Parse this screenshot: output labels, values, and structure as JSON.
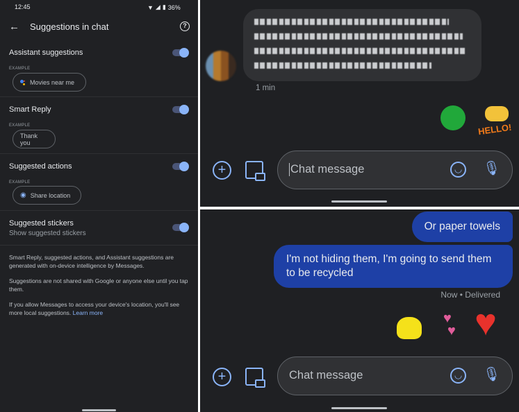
{
  "status_bar": {
    "time": "12:45",
    "battery": "36%"
  },
  "settings": {
    "title": "Suggestions in chat",
    "sections": [
      {
        "label": "Assistant suggestions",
        "example_label": "EXAMPLE",
        "chip": "Movies near me",
        "enabled": true
      },
      {
        "label": "Smart Reply",
        "example_label": "EXAMPLE",
        "chip": "Thank you",
        "enabled": true
      },
      {
        "label": "Suggested actions",
        "example_label": "EXAMPLE",
        "chip": "Share location",
        "enabled": true
      },
      {
        "label": "Suggested stickers",
        "subtitle": "Show suggested stickers",
        "enabled": true
      }
    ],
    "info": [
      "Smart Reply, suggested actions, and Assistant suggestions are generated with on-device intelligence by Messages.",
      "Suggestions are not shared with Google or anyone else until you tap them.",
      "If you allow Messages to access your device's location, you'll see more local suggestions."
    ],
    "learn_more": "Learn more"
  },
  "chat_top": {
    "incoming_time": "1 min",
    "input_placeholder": "Chat message"
  },
  "chat_bottom": {
    "messages": [
      "Or paper towels",
      "I'm not hiding them, I'm going to send them to be recycled"
    ],
    "status": "Now • Delivered",
    "input_placeholder": "Chat message"
  },
  "colors": {
    "accent": "#8ab4f8",
    "outgoing_bubble": "#1e40a6",
    "background": "#202124"
  }
}
